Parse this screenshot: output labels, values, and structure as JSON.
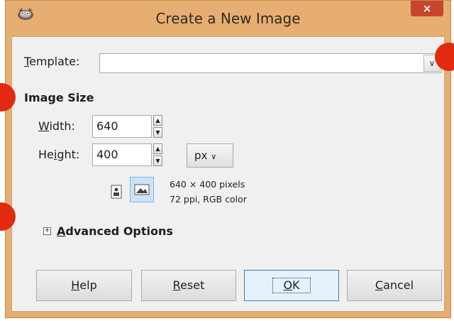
{
  "window": {
    "title": "Create a New Image",
    "close_label": "×",
    "app_icon": "gimp-icon"
  },
  "template": {
    "label_prefix": "",
    "label_accel": "T",
    "label_rest": "emplate:",
    "value": "",
    "dropdown_icon": "chevron-down-icon"
  },
  "image_size": {
    "heading": "Image Size",
    "width_label_accel": "W",
    "width_label_rest": "idth:",
    "width_value": "640",
    "height_label_prefix": "He",
    "height_label_accel": "i",
    "height_label_rest": "ght:",
    "height_value": "400",
    "unit": "px",
    "info_line1": "640 × 400 pixels",
    "info_line2": "72 ppi, RGB color"
  },
  "advanced": {
    "expander_symbol": "+",
    "label_accel": "A",
    "label_rest": "dvanced Options"
  },
  "buttons": {
    "help_accel": "H",
    "help_rest": "elp",
    "reset_accel": "R",
    "reset_rest": "eset",
    "ok_accel": "O",
    "ok_rest": "K",
    "cancel_accel": "C",
    "cancel_rest": "ancel"
  },
  "colors": {
    "window_frame": "#e6ae71",
    "close_button": "#c7442e",
    "marker": "#e22a10"
  }
}
